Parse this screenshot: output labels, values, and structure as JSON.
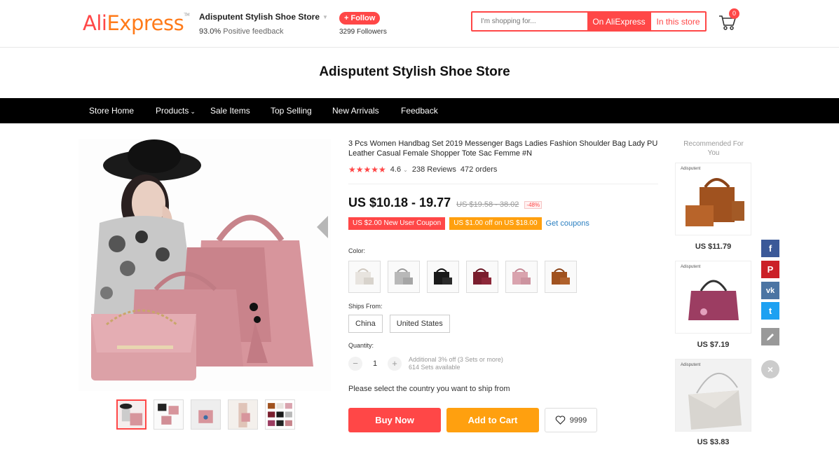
{
  "header": {
    "logo_ali": "Ali",
    "logo_express": "Express",
    "logo_tm": "TM",
    "store_name": "Adisputent Stylish Shoe Store",
    "feedback_pct": "93.0%",
    "feedback_label": "Positive feedback",
    "follow_label": "+ Follow",
    "followers": "3299 Followers",
    "search_placeholder": "I'm shopping for...",
    "search_aliexpress": "On AliExpress",
    "search_store": "In this store",
    "cart_count": "0"
  },
  "store_title": "Adisputent Stylish Shoe Store",
  "nav": {
    "items": [
      "Store Home",
      "Products",
      "Sale Items",
      "Top Selling",
      "New Arrivals",
      "Feedback"
    ]
  },
  "product": {
    "title": "3 Pcs Women Handbag Set 2019 Messenger Bags Ladies Fashion Shoulder Bag Lady PU Leather Casual Female Shopper Tote Sac Femme #N",
    "stars": "★★★★★",
    "rating": "4.6",
    "reviews": "238 Reviews",
    "orders": "472 orders",
    "price": "US $10.18 - 19.77",
    "old_price": "US $19.58 - 38.02",
    "discount": "-48%",
    "coupon1": "US $2.00 New User Coupon",
    "coupon2": "US $1.00 off on US $18.00",
    "coupon_link": "Get coupons",
    "color_label": "Color:",
    "ships_label": "Ships From:",
    "ships_options": [
      "China",
      "United States"
    ],
    "qty_label": "Quantity:",
    "qty_minus": "−",
    "qty_value": "1",
    "qty_plus": "+",
    "qty_note1": "Additional 3% off (3 Sets or more)",
    "qty_note2": "614 Sets available",
    "ship_msg": "Please select the country you want to ship from",
    "buy_now": "Buy Now",
    "add_to_cart": "Add to Cart",
    "wishlist_count": "9999",
    "swatch_colors": [
      "#e8e4df",
      "#b8b8b8",
      "#1a1a1a",
      "#7a1e2e",
      "#d9a3ae",
      "#a0521f"
    ]
  },
  "recommended": {
    "title": "Recommended For You",
    "items": [
      {
        "brand": "Adisputent",
        "price": "US $11.79",
        "color": "#a0521f"
      },
      {
        "brand": "Adisputent",
        "price": "US $7.19",
        "color": "#9c3d62"
      },
      {
        "brand": "Adisputent",
        "price": "US $3.83",
        "color": "#d8d5d0"
      }
    ]
  },
  "share": {
    "facebook": "f",
    "pinterest": "P",
    "vk": "vk",
    "twitter": "t",
    "close": "×"
  },
  "colors": {
    "accent": "#ff4747",
    "orange": "#ffa00f",
    "facebook": "#3b5998",
    "pinterest": "#cb2027",
    "vk": "#4c75a3",
    "twitter": "#1da1f2",
    "edit": "#999999"
  }
}
